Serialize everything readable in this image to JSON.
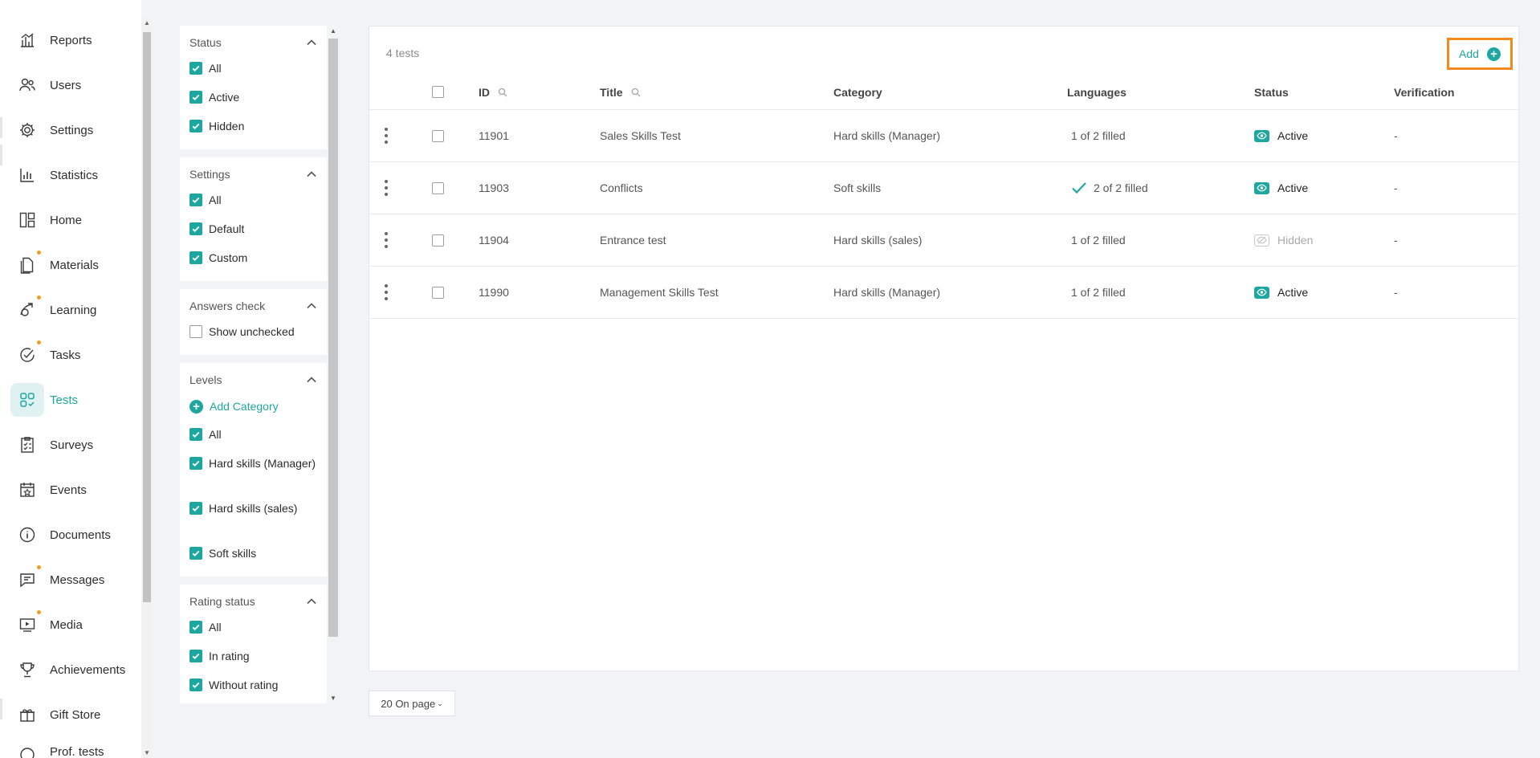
{
  "nav": {
    "items": [
      {
        "label": "Reports",
        "icon": "reports-icon",
        "dot": false,
        "active": false
      },
      {
        "label": "Users",
        "icon": "users-icon",
        "dot": false,
        "active": false
      },
      {
        "label": "Settings",
        "icon": "gear-icon",
        "dot": false,
        "active": false
      },
      {
        "label": "Statistics",
        "icon": "bar-chart-icon",
        "dot": false,
        "active": false
      },
      {
        "label": "Home",
        "icon": "home-grid-icon",
        "dot": false,
        "active": false
      },
      {
        "label": "Materials",
        "icon": "materials-icon",
        "dot": true,
        "active": false
      },
      {
        "label": "Learning",
        "icon": "learning-icon",
        "dot": true,
        "active": false
      },
      {
        "label": "Tasks",
        "icon": "tasks-check-icon",
        "dot": true,
        "active": false
      },
      {
        "label": "Tests",
        "icon": "tests-grid-icon",
        "dot": false,
        "active": true
      },
      {
        "label": "Surveys",
        "icon": "survey-icon",
        "dot": false,
        "active": false
      },
      {
        "label": "Events",
        "icon": "calendar-star-icon",
        "dot": false,
        "active": false
      },
      {
        "label": "Documents",
        "icon": "info-icon",
        "dot": false,
        "active": false
      },
      {
        "label": "Messages",
        "icon": "message-icon",
        "dot": true,
        "active": false
      },
      {
        "label": "Media",
        "icon": "media-icon",
        "dot": true,
        "active": false
      },
      {
        "label": "Achievements",
        "icon": "trophy-icon",
        "dot": false,
        "active": false
      },
      {
        "label": "Gift Store",
        "icon": "gift-icon",
        "dot": false,
        "active": false
      },
      {
        "label": "Prof. tests",
        "icon": "prof-tests-icon",
        "dot": false,
        "active": false
      }
    ]
  },
  "filters": {
    "status": {
      "title": "Status",
      "options": [
        {
          "label": "All",
          "checked": true
        },
        {
          "label": "Active",
          "checked": true
        },
        {
          "label": "Hidden",
          "checked": true
        }
      ]
    },
    "settings": {
      "title": "Settings",
      "options": [
        {
          "label": "All",
          "checked": true
        },
        {
          "label": "Default",
          "checked": true
        },
        {
          "label": "Custom",
          "checked": true
        }
      ]
    },
    "answers": {
      "title": "Answers check",
      "options": [
        {
          "label": "Show unchecked",
          "checked": false
        }
      ]
    },
    "levels": {
      "title": "Levels",
      "add_label": "Add Category",
      "options": [
        {
          "label": "All",
          "checked": true
        },
        {
          "label": "Hard skills (Manager)",
          "checked": true
        },
        {
          "label": "Hard skills (sales)",
          "checked": true
        },
        {
          "label": "Soft skills",
          "checked": true
        }
      ]
    },
    "rating": {
      "title": "Rating status",
      "options": [
        {
          "label": "All",
          "checked": true
        },
        {
          "label": "In rating",
          "checked": true
        },
        {
          "label": "Without rating",
          "checked": true
        }
      ]
    }
  },
  "table": {
    "count_text": "4 tests",
    "add_label": "Add",
    "columns": {
      "id": "ID",
      "title": "Title",
      "category": "Category",
      "languages": "Languages",
      "status": "Status",
      "verification": "Verification"
    },
    "rows": [
      {
        "id": "11901",
        "title": "Sales Skills Test",
        "category": "Hard skills (Manager)",
        "languages": "1 of 2 filled",
        "lang_complete": false,
        "status": "Active",
        "status_active": true,
        "verification": "-"
      },
      {
        "id": "11903",
        "title": "Conflicts",
        "category": "Soft skills",
        "languages": "2 of 2 filled",
        "lang_complete": true,
        "status": "Active",
        "status_active": true,
        "verification": "-"
      },
      {
        "id": "11904",
        "title": "Entrance test",
        "category": "Hard skills (sales)",
        "languages": "1 of 2 filled",
        "lang_complete": false,
        "status": "Hidden",
        "status_active": false,
        "verification": "-"
      },
      {
        "id": "11990",
        "title": "Management Skills Test",
        "category": "Hard skills (Manager)",
        "languages": "1 of 2 filled",
        "lang_complete": false,
        "status": "Active",
        "status_active": true,
        "verification": "-"
      }
    ]
  },
  "pager": {
    "label": "20 On page"
  },
  "colors": {
    "accent": "#1ea7a0",
    "highlight": "#f28a1e",
    "badge": "#f39a1f"
  }
}
